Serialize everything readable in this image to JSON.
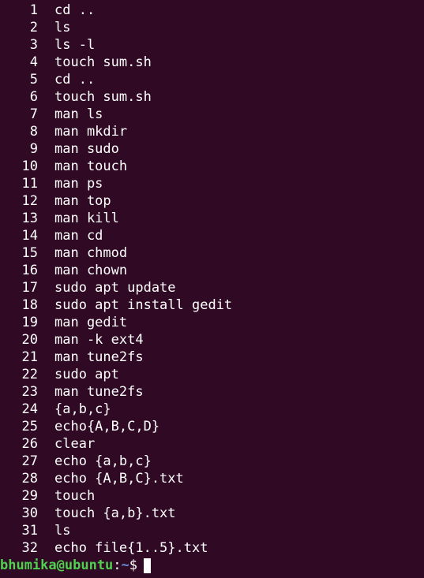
{
  "history": [
    {
      "num": "1",
      "cmd": "cd .."
    },
    {
      "num": "2",
      "cmd": "ls"
    },
    {
      "num": "3",
      "cmd": "ls -l"
    },
    {
      "num": "4",
      "cmd": "touch sum.sh"
    },
    {
      "num": "5",
      "cmd": "cd .."
    },
    {
      "num": "6",
      "cmd": "touch sum.sh"
    },
    {
      "num": "7",
      "cmd": "man ls"
    },
    {
      "num": "8",
      "cmd": "man mkdir"
    },
    {
      "num": "9",
      "cmd": "man sudo"
    },
    {
      "num": "10",
      "cmd": "man touch"
    },
    {
      "num": "11",
      "cmd": "man ps"
    },
    {
      "num": "12",
      "cmd": "man top"
    },
    {
      "num": "13",
      "cmd": "man kill"
    },
    {
      "num": "14",
      "cmd": "man cd"
    },
    {
      "num": "15",
      "cmd": "man chmod"
    },
    {
      "num": "16",
      "cmd": "man chown"
    },
    {
      "num": "17",
      "cmd": "sudo apt update"
    },
    {
      "num": "18",
      "cmd": "sudo apt install gedit"
    },
    {
      "num": "19",
      "cmd": "man gedit"
    },
    {
      "num": "20",
      "cmd": "man -k ext4"
    },
    {
      "num": "21",
      "cmd": "man tune2fs"
    },
    {
      "num": "22",
      "cmd": "sudo apt"
    },
    {
      "num": "23",
      "cmd": "man tune2fs"
    },
    {
      "num": "24",
      "cmd": "{a,b,c}"
    },
    {
      "num": "25",
      "cmd": "echo{A,B,C,D}"
    },
    {
      "num": "26",
      "cmd": "clear"
    },
    {
      "num": "27",
      "cmd": "echo {a,b,c}"
    },
    {
      "num": "28",
      "cmd": "echo {A,B,C}.txt"
    },
    {
      "num": "29",
      "cmd": "touch"
    },
    {
      "num": "30",
      "cmd": "touch {a,b}.txt"
    },
    {
      "num": "31",
      "cmd": "ls"
    },
    {
      "num": "32",
      "cmd": "echo file{1..5}.txt"
    }
  ],
  "prompt": {
    "user_host": "bhumika@ubuntu",
    "separator": ":",
    "path": "~",
    "symbol": "$"
  },
  "colors": {
    "background": "#300a24",
    "text": "#ffffff",
    "user_host": "#4fd14f",
    "path": "#6b8fd6"
  }
}
